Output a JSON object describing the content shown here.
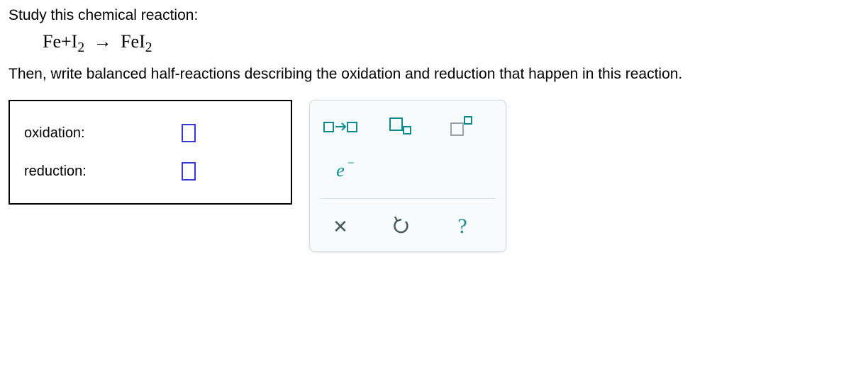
{
  "prompt": "Study this chemical reaction:",
  "equation": {
    "reactant1": "Fe",
    "plus": "+",
    "reactant2_base": "I",
    "reactant2_sub": "2",
    "arrow": "→",
    "product_base": "FeI",
    "product_sub": "2"
  },
  "instruction": "Then, write balanced half-reactions describing the oxidation and reduction that happen in this reaction.",
  "answers": {
    "oxidation_label": "oxidation:",
    "reduction_label": "reduction:"
  },
  "palette": {
    "yields_tool": "yields",
    "subscript_tool": "subscript",
    "superscript_tool": "superscript",
    "electron_tool": "e",
    "clear_tool": "✕",
    "undo_tool": "↺",
    "help_tool": "?"
  }
}
